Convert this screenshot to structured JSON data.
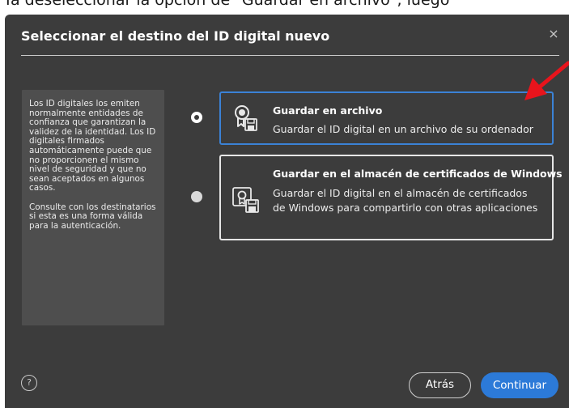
{
  "page": {
    "top_caption": "Ya deseleccionar la opción de \"Guardar en archivo\", luego"
  },
  "dialog": {
    "title": "Seleccionar el destino del ID digital nuevo",
    "close_symbol": "×",
    "info_paragraphs": [
      "Los ID digitales los emiten normalmente entidades de confianza que garantizan la validez de la identidad. Los ID digitales firmados automáticamente puede que no proporcionen el mismo nivel de seguridad y que no sean aceptados en algunos casos.",
      "Consulte con los destinatarios si esta es una forma válida para la autenticación."
    ],
    "options": [
      {
        "title": "Guardar en archivo",
        "description": "Guardar el ID digital en un archivo de su ordenador",
        "selected": true,
        "icon": "certificate-file-icon"
      },
      {
        "title": "Guardar en el almacén de certificados de Windows",
        "description": "Guardar el ID digital en el almacén de certificados de Windows para compartirlo con otras aplicaciones",
        "selected": false,
        "icon": "certificate-store-icon"
      }
    ],
    "help_symbol": "?",
    "buttons": {
      "back": "Atrás",
      "continue": "Continuar"
    },
    "colors": {
      "background": "#3c3c3c",
      "panel": "#4e4e4e",
      "accent": "#2c7ad8",
      "selected_border": "#3b82d6",
      "annotation_arrow": "#e8141c"
    }
  }
}
